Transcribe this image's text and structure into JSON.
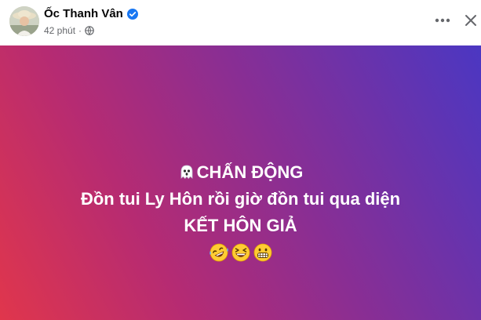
{
  "header": {
    "author": "Ốc Thanh Vân",
    "time": "42 phút",
    "separator": "·"
  },
  "post": {
    "line1": "CHẤN ĐỘNG",
    "line2": "Đồn tui Ly Hôn rồi giờ đồn tui qua diện",
    "line3": "KẾT HÔN GIẢ"
  },
  "icons": {
    "lead": "ghost-icon",
    "reactions": [
      "rolling-laughing-icon",
      "grinning-squinting-icon",
      "grimacing-icon"
    ],
    "verified": "verified-badge-icon",
    "privacy": "globe-icon"
  },
  "colors": {
    "verified": "#1877f2",
    "gradient_start": "#e0364c",
    "gradient_mid": "#8a2e93",
    "gradient_end": "#4b37c2",
    "name_text": "#050505",
    "meta_text": "#65676b"
  }
}
